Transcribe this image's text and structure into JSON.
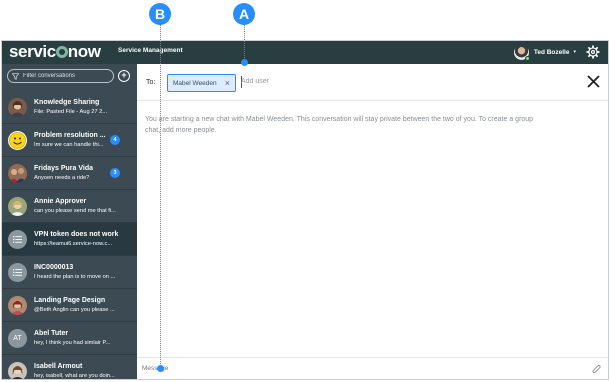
{
  "header": {
    "logo_text_pre": "servic",
    "logo_text_post": "now",
    "app_title": "Service Management",
    "user_name": "Ted Bozelle",
    "user_caret": "▾"
  },
  "sidebar": {
    "filter_placeholder": "Filter conversations",
    "new_chat_label": "+",
    "conversations": [
      {
        "title": "Knowledge Sharing",
        "subtitle": "File: Pasted File - Aug 27 2...",
        "badge": "",
        "avatar": "photo-woman"
      },
      {
        "title": "Problem resolution ...",
        "subtitle": "Im sure we can handle thi...",
        "badge": "4",
        "avatar": "smiley"
      },
      {
        "title": "Fridays Pura Vida",
        "subtitle": "Anyoen needs a ride?",
        "badge": "3",
        "avatar": "photo-group"
      },
      {
        "title": "Annie Approver",
        "subtitle": "can you please send me that fi...",
        "badge": "",
        "avatar": "photo-woman2"
      },
      {
        "title": "VPN token does not work",
        "subtitle": "https://teamui6.service-now.c...",
        "badge": "",
        "avatar": "list"
      },
      {
        "title": "INC0000013",
        "subtitle": "I heard the plan is to move on ...",
        "badge": "",
        "avatar": "list"
      },
      {
        "title": "Landing Page Design",
        "subtitle": "@Beth Anglin can you please ...",
        "badge": "",
        "avatar": "photo-man"
      },
      {
        "title": "Abel Tuter",
        "subtitle": "hey, I think you had simlair P...",
        "badge": "",
        "avatar": "initials",
        "initials": "AT"
      },
      {
        "title": "Isabell Armout",
        "subtitle": "hey, isabell, what are you doin...",
        "badge": "",
        "avatar": "photo-woman3"
      }
    ]
  },
  "main": {
    "to_label": "To:",
    "recipient_chip": "Mabel Weeden",
    "add_user_placeholder": "Add user",
    "intro_text": "You are starting a new chat with Mabel Weeden. This conversation will stay private between the two of you. To create a group chat, add more people.",
    "message_placeholder": "Message"
  },
  "callouts": {
    "a_label": "A",
    "b_label": "B"
  },
  "colors": {
    "header_bg": "#293e40",
    "sidebar_bg": "#3b4a53",
    "accent": "#278efc",
    "chip_bg": "#dcecfd"
  }
}
